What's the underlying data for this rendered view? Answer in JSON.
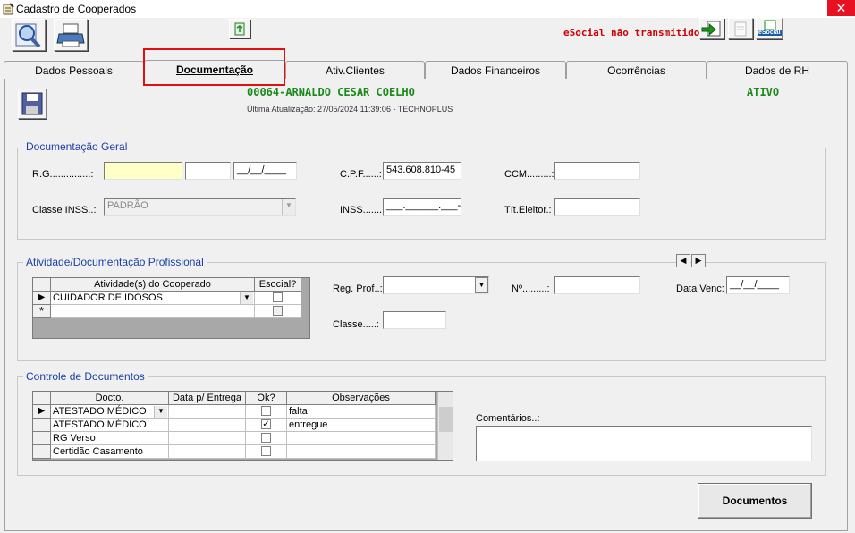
{
  "window": {
    "title": "Cadastro de Cooperados",
    "close": "✕"
  },
  "toolbar": {
    "esocial_status": "eSocial não transmitido",
    "esocial_btn": "eSocial"
  },
  "tabs": [
    {
      "label": "Dados Pessoais"
    },
    {
      "label": "Documentação"
    },
    {
      "label": "Ativ.Clientes"
    },
    {
      "label": "Dados Financeiros"
    },
    {
      "label": "Ocorrências"
    },
    {
      "label": "Dados de RH"
    }
  ],
  "cooperado": {
    "name": "00064-ARNALDO CESAR COELHO",
    "status": "ATIVO",
    "last_update": "Última Atualização: 27/05/2024 11:39:06 - TECHNOPLUS"
  },
  "doc_geral": {
    "legend": "Documentação Geral",
    "rg_label": "R.G...............:",
    "rg_date": "__/__/____",
    "cpf_label": "C.P.F......:",
    "cpf_value": "543.608.810-45",
    "ccm_label": "CCM.........:",
    "classe_inss_label": "Classe INSS..:",
    "classe_inss_value": "PADRÃO",
    "inss_label": "INSS.......:",
    "inss_value": "___.______.___-_",
    "titulo_label": "Tít.Eleitor.:"
  },
  "atividade": {
    "legend": "Atividade/Documentação Profissional",
    "col_atividade": "Atividade(s) do Cooperado",
    "col_esocial": "Esocial?",
    "rows": [
      {
        "atividade": "CUIDADOR DE IDOSOS",
        "esocial": false
      }
    ],
    "new_row_marker": "*",
    "reg_prof_label": "Reg. Prof..:",
    "numero_label": "Nº.........:",
    "data_venc_label": "Data Venc:",
    "data_venc_value": "__/__/____",
    "classe_label": "Classe.....:"
  },
  "controle": {
    "legend": "Controle de Documentos",
    "headers": [
      "Docto.",
      "Data p/ Entrega",
      "Ok?",
      "Observações"
    ],
    "rows": [
      {
        "docto": "ATESTADO MÉDICO",
        "data": "",
        "ok": false,
        "obs": "falta"
      },
      {
        "docto": "ATESTADO MÉDICO",
        "data": "",
        "ok": true,
        "obs": "entregue"
      },
      {
        "docto": "RG Verso",
        "data": "",
        "ok": false,
        "obs": ""
      },
      {
        "docto": "Certidão Casamento",
        "data": "",
        "ok": false,
        "obs": ""
      }
    ],
    "comentarios_label": "Comentários..:"
  },
  "buttons": {
    "documentos": "Documentos"
  }
}
